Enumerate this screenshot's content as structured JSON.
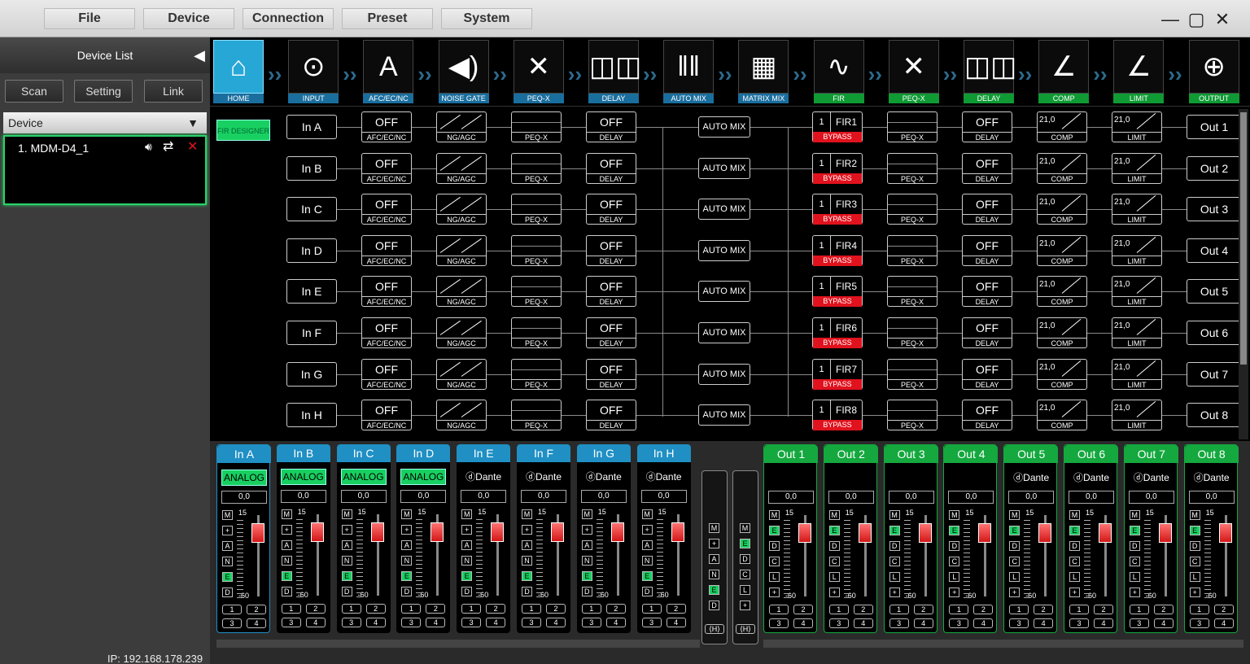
{
  "menu": {
    "items": [
      "File",
      "Device",
      "Connection",
      "Preset",
      "System"
    ],
    "minimize": "—",
    "maximize": "▢",
    "close": "✕"
  },
  "sidebar": {
    "title": "Device List",
    "buttons": [
      "Scan",
      "Setting",
      "Link"
    ],
    "device_dropdown": "Device",
    "device_name": "1. MDM-D4_1",
    "ip": "IP: 192.168.178.239"
  },
  "toolbar": {
    "tools": [
      "HOME",
      "INPUT",
      "AFC/EC/NC",
      "NOISE GATE",
      "PEQ-X",
      "DELAY",
      "AUTO MIX",
      "MATRIX MIX",
      "FIR",
      "PEQ-X",
      "DELAY",
      "COMP",
      "LIMIT",
      "OUTPUT"
    ],
    "icons": [
      "home-icon",
      "xlr-input-icon",
      "letter-a-icon",
      "speaker-gate-icon",
      "peq-x-icon",
      "delay-speakers-icon",
      "sliders-icon",
      "matrix-grid-icon",
      "waveform-icon",
      "peq-x-icon",
      "delay-speakers-icon",
      "comp-curve-icon",
      "limit-curve-icon",
      "output-connector-icon"
    ]
  },
  "routing": {
    "fir_designer": "FIR DESIGNER",
    "inputs": [
      "In A",
      "In B",
      "In C",
      "In D",
      "In E",
      "In F",
      "In G",
      "In H"
    ],
    "outputs": [
      "Out 1",
      "Out 2",
      "Out 3",
      "Out 4",
      "Out 5",
      "Out 6",
      "Out 7",
      "Out 8"
    ],
    "fir": [
      "FIR1",
      "FIR2",
      "FIR3",
      "FIR4",
      "FIR5",
      "FIR6",
      "FIR7",
      "FIR8"
    ],
    "fir_num": "1",
    "bypass": "BYPASS",
    "off": "OFF",
    "afc_lbl": "AFC/EC/NC",
    "ng_lbl": "NG/AGC",
    "peq_lbl": "PEQ-X",
    "delay_lbl": "DELAY",
    "automix": "AUTO MIX",
    "comp_lbl": "COMP",
    "limit_lbl": "LIMIT",
    "comp_val": "21,0",
    "limit_val": "21,0"
  },
  "mixer": {
    "inputs": [
      {
        "name": "In A",
        "source": "ANALOG"
      },
      {
        "name": "In B",
        "source": "ANALOG"
      },
      {
        "name": "In C",
        "source": "ANALOG"
      },
      {
        "name": "In D",
        "source": "ANALOG"
      },
      {
        "name": "In E",
        "source": "ⓓDante"
      },
      {
        "name": "In F",
        "source": "ⓓDante"
      },
      {
        "name": "In G",
        "source": "ⓓDante"
      },
      {
        "name": "In H",
        "source": "ⓓDante"
      }
    ],
    "outputs": [
      {
        "name": "Out 1",
        "source": ""
      },
      {
        "name": "Out 2",
        "source": ""
      },
      {
        "name": "Out 3",
        "source": ""
      },
      {
        "name": "Out 4",
        "source": ""
      },
      {
        "name": "Out 5",
        "source": "ⓓDante"
      },
      {
        "name": "Out 6",
        "source": "ⓓDante"
      },
      {
        "name": "Out 7",
        "source": "ⓓDante"
      },
      {
        "name": "Out 8",
        "source": "ⓓDante"
      }
    ],
    "gain": "0,0",
    "scale_top": "15",
    "scale_bot": "-60",
    "in_buttons": [
      "M",
      "+",
      "A",
      "N",
      "E",
      "D"
    ],
    "out_buttons": [
      "M",
      "E",
      "D",
      "C",
      "L",
      "+"
    ],
    "bus": [
      "1",
      "2",
      "3",
      "4"
    ],
    "link_left": [
      "M",
      "+",
      "A",
      "N",
      "E",
      "D"
    ],
    "link_right": [
      "M",
      "E",
      "D",
      "C",
      "L",
      "+"
    ],
    "link_icon": "⟨H⟩"
  },
  "colors": {
    "accent": "#27a7d6",
    "green": "#18d061",
    "red": "#e0121d",
    "input_header": "#1f8fc4",
    "output_header": "#14a83e"
  }
}
